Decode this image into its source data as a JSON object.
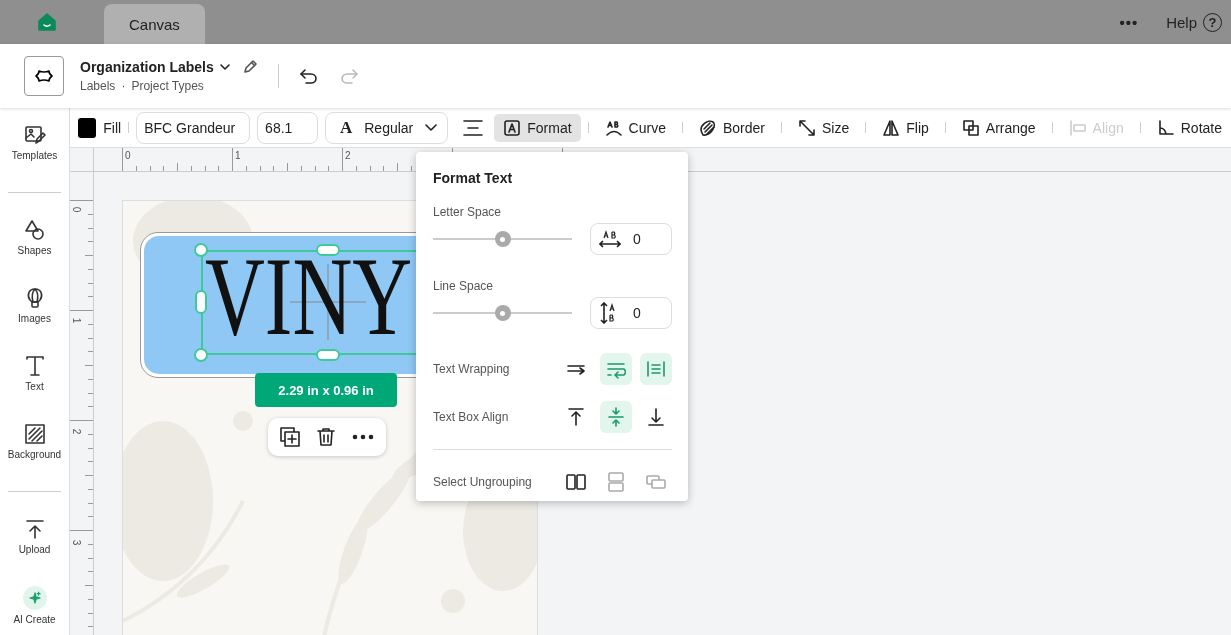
{
  "tabs": [
    {
      "label": "Canvas",
      "selected": true
    }
  ],
  "top_actions": {
    "more": "•••",
    "help": "Help",
    "help_icon": "?"
  },
  "project": {
    "title": "Organization Labels",
    "breadcrumbs": [
      "Labels",
      "Project Types"
    ],
    "separator": "·"
  },
  "history": [
    {
      "kind": "undo",
      "disabled": false
    },
    {
      "kind": "redo",
      "disabled": true
    }
  ],
  "sidebar": {
    "groups": [
      [
        {
          "label": "Templates"
        }
      ],
      [
        {
          "label": "Shapes"
        },
        {
          "label": "Images"
        },
        {
          "label": "Text"
        },
        {
          "label": "Background"
        }
      ],
      [
        {
          "label": "Upload"
        },
        {
          "label": "AI Create"
        }
      ]
    ]
  },
  "toolbar": {
    "fill": {
      "label": "Fill",
      "color": "#000000"
    },
    "font": "BFC Grandeur",
    "size": "68.1",
    "style_icon": "A",
    "style": "Regular",
    "tools": [
      {
        "label": "Format",
        "selected": true,
        "disabled": false
      },
      {
        "label": "Curve",
        "selected": false,
        "disabled": false
      },
      {
        "label": "Border",
        "selected": false,
        "disabled": false
      },
      {
        "label": "Size",
        "selected": false,
        "disabled": false
      },
      {
        "label": "Flip",
        "selected": false,
        "disabled": false
      },
      {
        "label": "Arrange",
        "selected": false,
        "disabled": false
      },
      {
        "label": "Align",
        "selected": false,
        "disabled": true
      },
      {
        "label": "Rotate",
        "selected": false,
        "disabled": false
      }
    ]
  },
  "rulers": {
    "horizontal": [
      "0",
      "1",
      "2"
    ],
    "vertical": [
      "0",
      "1",
      "2",
      "3"
    ]
  },
  "canvas": {
    "text": "VINY",
    "dimensions": "2.29 in x 0.96 in"
  },
  "format_popup": {
    "title": "Format Text",
    "sliders": [
      {
        "label": "Letter Space",
        "level": 0.5,
        "value": "0"
      },
      {
        "label": "Line Space",
        "level": 0.5,
        "value": "0"
      }
    ],
    "option_rows": [
      {
        "label": "Text Wrapping",
        "options": [
          {
            "selected": false
          },
          {
            "selected": true
          },
          {
            "selected": true
          }
        ]
      },
      {
        "label": "Text Box Align",
        "options": [
          {
            "selected": false
          },
          {
            "selected": true
          },
          {
            "selected": false
          }
        ]
      }
    ],
    "ungrouping": {
      "label": "Select Ungrouping",
      "options": [
        {
          "disabled": false
        },
        {
          "disabled": true
        },
        {
          "disabled": true
        }
      ]
    }
  }
}
